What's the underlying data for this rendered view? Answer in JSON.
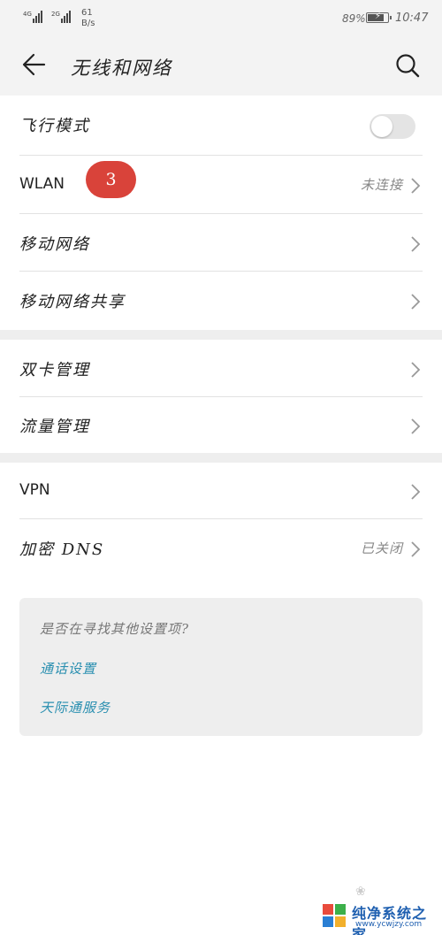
{
  "status_bar": {
    "sim1_network": "4G",
    "sim2_network": "2G",
    "speed_value": "61",
    "speed_unit": "B/s",
    "battery_percent": "89%",
    "battery_level": 0.89,
    "time": "10:47"
  },
  "header": {
    "title": "无线和网络",
    "back_icon": "arrow-left-icon",
    "search_icon": "search-icon"
  },
  "settings": {
    "airplane_mode": {
      "label": "飞行模式",
      "enabled": false
    },
    "wlan": {
      "label": "WLAN",
      "badge": "3",
      "value": "未连接"
    },
    "mobile_network": {
      "label": "移动网络"
    },
    "tethering": {
      "label": "移动网络共享"
    },
    "dual_sim": {
      "label": "双卡管理"
    },
    "data_usage": {
      "label": "流量管理"
    },
    "vpn": {
      "label": "VPN"
    },
    "private_dns": {
      "label": "加密 DNS",
      "value": "已关闭"
    }
  },
  "suggestions": {
    "question": "是否在寻找其他设置项?",
    "links": [
      "通话设置",
      "天际通服务"
    ]
  },
  "watermark": {
    "brand": "纯净系统之家",
    "url": "www.ycwjzy.com"
  },
  "colors": {
    "badge": "#d9433a",
    "link": "#2a8fb0",
    "watermark": "#1e5fb0"
  }
}
